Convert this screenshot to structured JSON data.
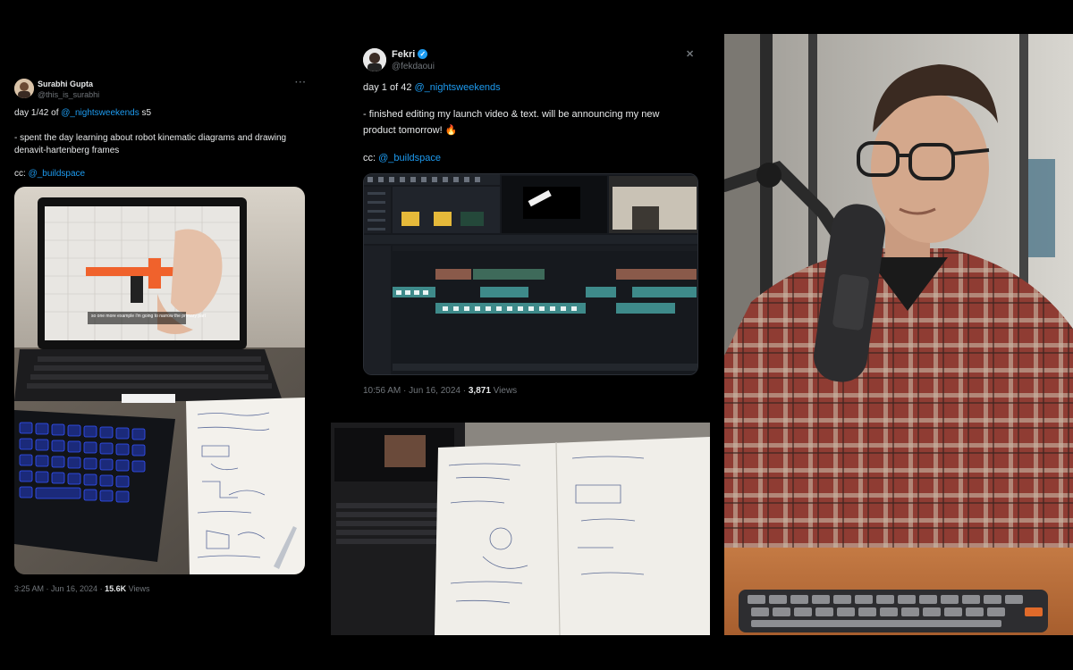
{
  "tweet_left": {
    "name": "Surabhi Gupta",
    "handle": "@this_is_surabhi",
    "line1_prefix": "day 1/42 of ",
    "line1_link": "@_nightsweekends",
    "line1_suffix": " s5",
    "line2": "- spent the day learning about robot kinematic diagrams and drawing",
    "line3": "denavit-hartenberg frames",
    "line4_prefix": "cc: ",
    "line4_link": "@_buildspace",
    "time": "3:25 AM · Jun 16, 2024 · ",
    "views_count": "15.6K",
    "views_label": " Views",
    "caption": "so one more example i'm going to narrow the primary part"
  },
  "tweet_right": {
    "name": "Fekri",
    "handle": "@fekdaoui",
    "line1_prefix": "day 1 of 42 ",
    "line1_link": "@_nightsweekends",
    "line2": "- finished editing my launch video & text. will be announcing my new",
    "line3": "product tomorrow! 🔥",
    "line4_prefix": "cc: ",
    "line4_link": "@_buildspace",
    "time": "10:56 AM · Jun 16, 2024 · ",
    "views_count": "3,871",
    "views_label": " Views"
  },
  "colors": {
    "background": "#000000",
    "link": "#1d9bf0",
    "muted": "#71767b"
  }
}
